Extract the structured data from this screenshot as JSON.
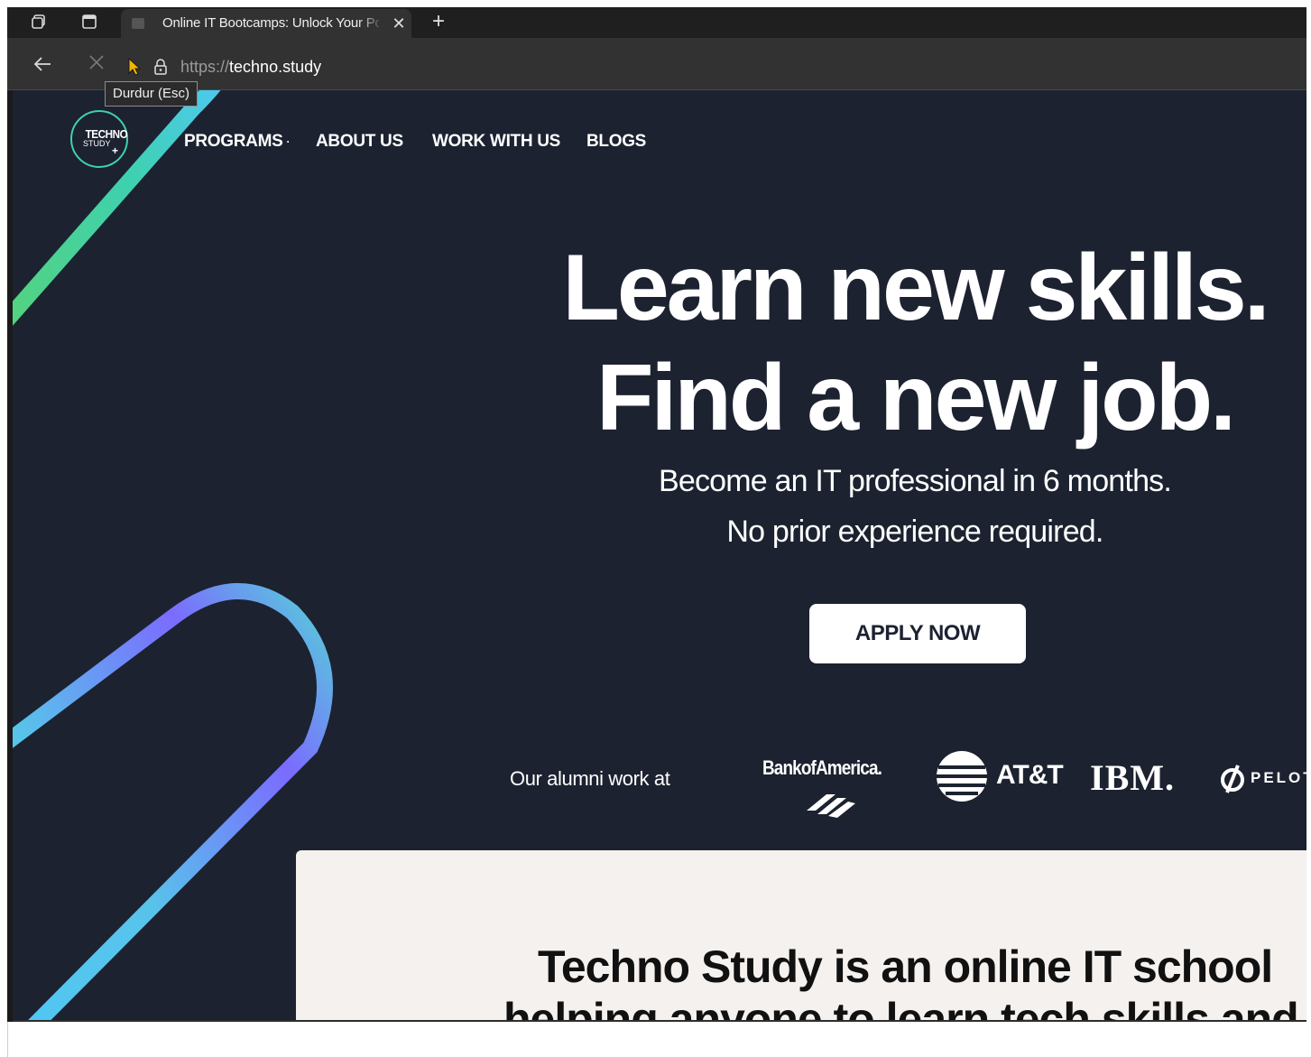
{
  "browser": {
    "tab_title": "Online IT Bootcamps: Unlock Your Potential",
    "url_protocol": "https://",
    "url_host": "techno.study",
    "tooltip": "Durdur (Esc)"
  },
  "logo": {
    "line1": "TECHNO",
    "line2": "STUDY",
    "plus": "+"
  },
  "nav": {
    "programs": "PROGRAMS",
    "about": "ABOUT US",
    "work": "WORK WITH US",
    "blogs": "BLOGS"
  },
  "hero": {
    "headline_line1": "Learn new skills.",
    "headline_line2": "Find a new job.",
    "subtitle_line1": "Become an IT professional in 6 months.",
    "subtitle_line2": "No prior experience required.",
    "cta": "APPLY NOW"
  },
  "alumni": {
    "label": "Our alumni work at",
    "companies": [
      "BankofAmerica.",
      "AT&T",
      "IBM.",
      "PELOTON"
    ]
  },
  "intro": {
    "line1": "Techno Study is an online IT school",
    "line2": "helping anyone to learn tech skills and"
  },
  "colors": {
    "page_bg": "#1c2230",
    "accent_teal": "#3ed1b0",
    "accent_purple": "#7b6bff",
    "card_bg": "#f5f1ee"
  }
}
